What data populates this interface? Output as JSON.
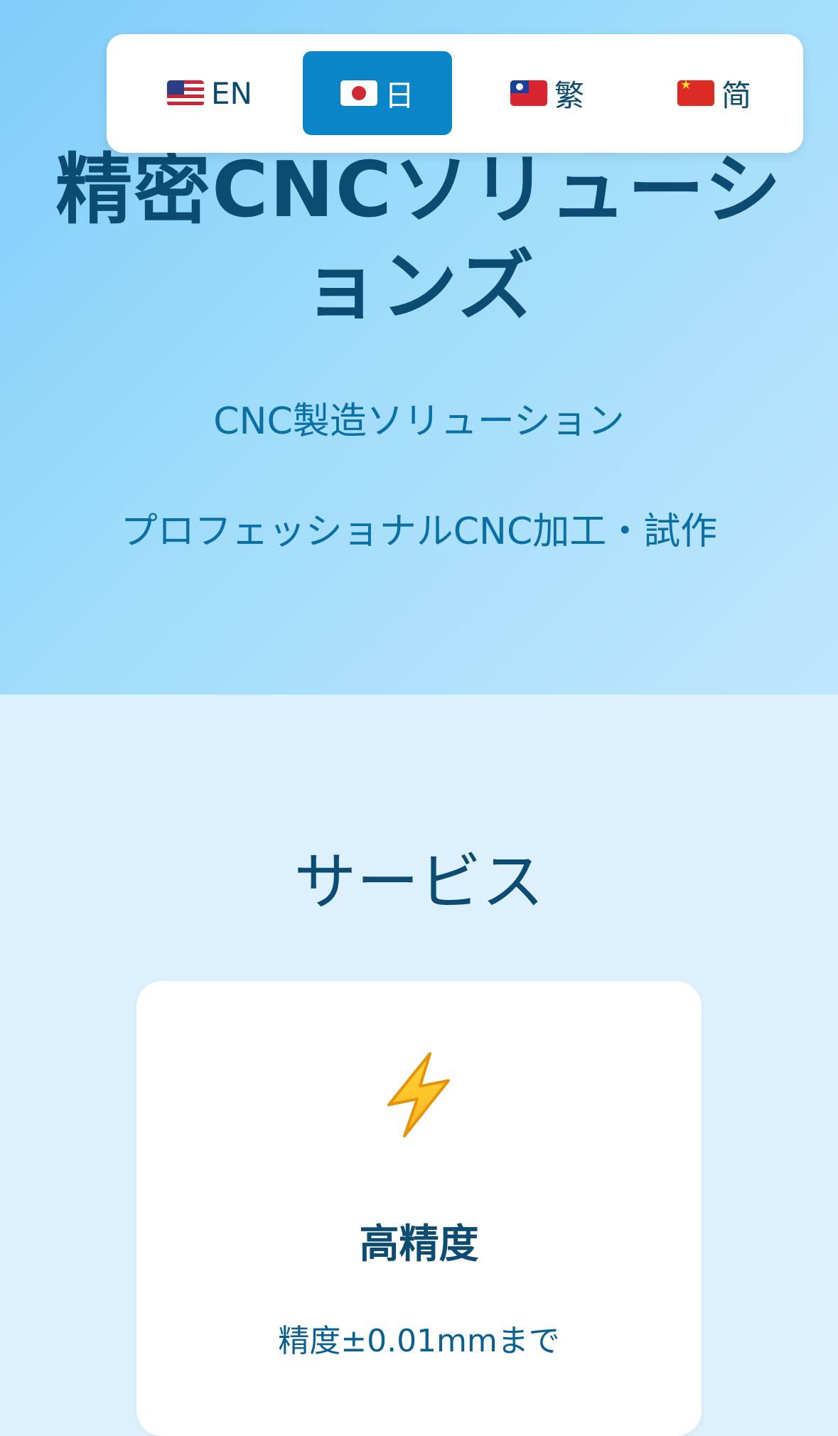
{
  "language_bar": {
    "items": [
      {
        "label": "EN",
        "flag": "us-flag-icon",
        "active": false
      },
      {
        "label": "日",
        "flag": "japan-flag-icon",
        "active": true
      },
      {
        "label": "繁",
        "flag": "taiwan-flag-icon",
        "active": false
      },
      {
        "label": "简",
        "flag": "china-flag-icon",
        "active": false
      }
    ],
    "active_color": "#0a85c8"
  },
  "hero": {
    "title": "精密CNCソリューションズ",
    "subtitle": "CNC製造ソリューション",
    "tagline": "プロフェッショナルCNC加工・試作"
  },
  "services": {
    "heading": "サービス",
    "cards": [
      {
        "icon": "lightning-icon",
        "title": "高精度",
        "description": "精度±0.01mmまで"
      }
    ]
  },
  "colors": {
    "hero_gradient_start": "#7fcdf9",
    "hero_gradient_end": "#bfe6fc",
    "section_background": "#ddf0fd",
    "heading_text": "#0c4b72",
    "body_text": "#0a6fa5"
  }
}
